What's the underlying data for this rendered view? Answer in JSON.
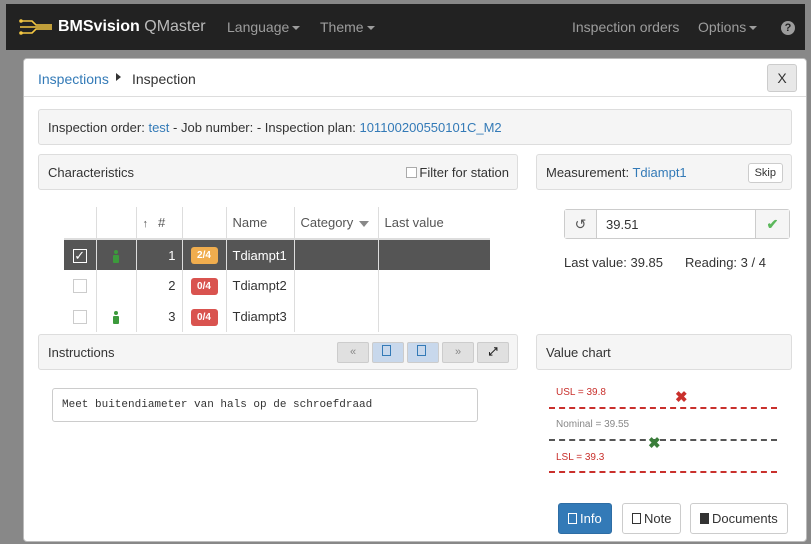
{
  "navbar": {
    "brand_bold": "BMSvision",
    "brand_light": "QMaster",
    "language": "Language",
    "theme": "Theme",
    "inspection_orders": "Inspection orders",
    "options": "Options",
    "help": "?"
  },
  "header": {
    "breadcrumb_link": "Inspections",
    "breadcrumb_current": "Inspection",
    "close": "X"
  },
  "order_bar": {
    "order_label": "Inspection order: ",
    "order_value": "test",
    "job_label": " - Job number: - Inspection plan: ",
    "plan_value": "101100200550101C_M2"
  },
  "characteristics": {
    "title": "Characteristics",
    "filter_label": "Filter for station",
    "columns": {
      "sort": "↑",
      "num": "#",
      "name": "Name",
      "category": "Category",
      "last_value": "Last value"
    },
    "rows": [
      {
        "checked": true,
        "operator": true,
        "num": "1",
        "badge": "2/4",
        "badge_color": "#f0ad4e",
        "name": "Tdiampt1",
        "category": "",
        "last_value": ""
      },
      {
        "checked": false,
        "operator": false,
        "num": "2",
        "badge": "0/4",
        "badge_color": "#d9534f",
        "name": "Tdiampt2",
        "category": "",
        "last_value": ""
      },
      {
        "checked": false,
        "operator": true,
        "num": "3",
        "badge": "0/4",
        "badge_color": "#d9534f",
        "name": "Tdiampt3",
        "category": "",
        "last_value": ""
      }
    ]
  },
  "measurement": {
    "label": "Measurement: ",
    "name": "Tdiampt1",
    "skip": "Skip",
    "input_value": "39.51",
    "last_value": "Last value: 39.85",
    "reading": "Reading: 3 / 4"
  },
  "instructions": {
    "title": "Instructions",
    "text": "Meet buitendiameter van hals op de schroefdraad",
    "tools": [
      "«",
      "doc-icon",
      "doc-icon",
      "»",
      "expand-icon"
    ]
  },
  "value_chart": {
    "title": "Value chart",
    "usl": "USL = 39.8",
    "nominal": "Nominal = 39.55",
    "lsl": "LSL = 39.3",
    "marks": [
      {
        "value": 39.85,
        "status": "out"
      },
      {
        "value": 39.51,
        "status": "ok"
      }
    ],
    "colors": {
      "limit": "#c9302c",
      "nominal": "#555555",
      "out": "#c9302c",
      "ok": "#3a7d3a"
    }
  },
  "footer": {
    "info": "Info",
    "note": "Note",
    "documents": "Documents"
  }
}
